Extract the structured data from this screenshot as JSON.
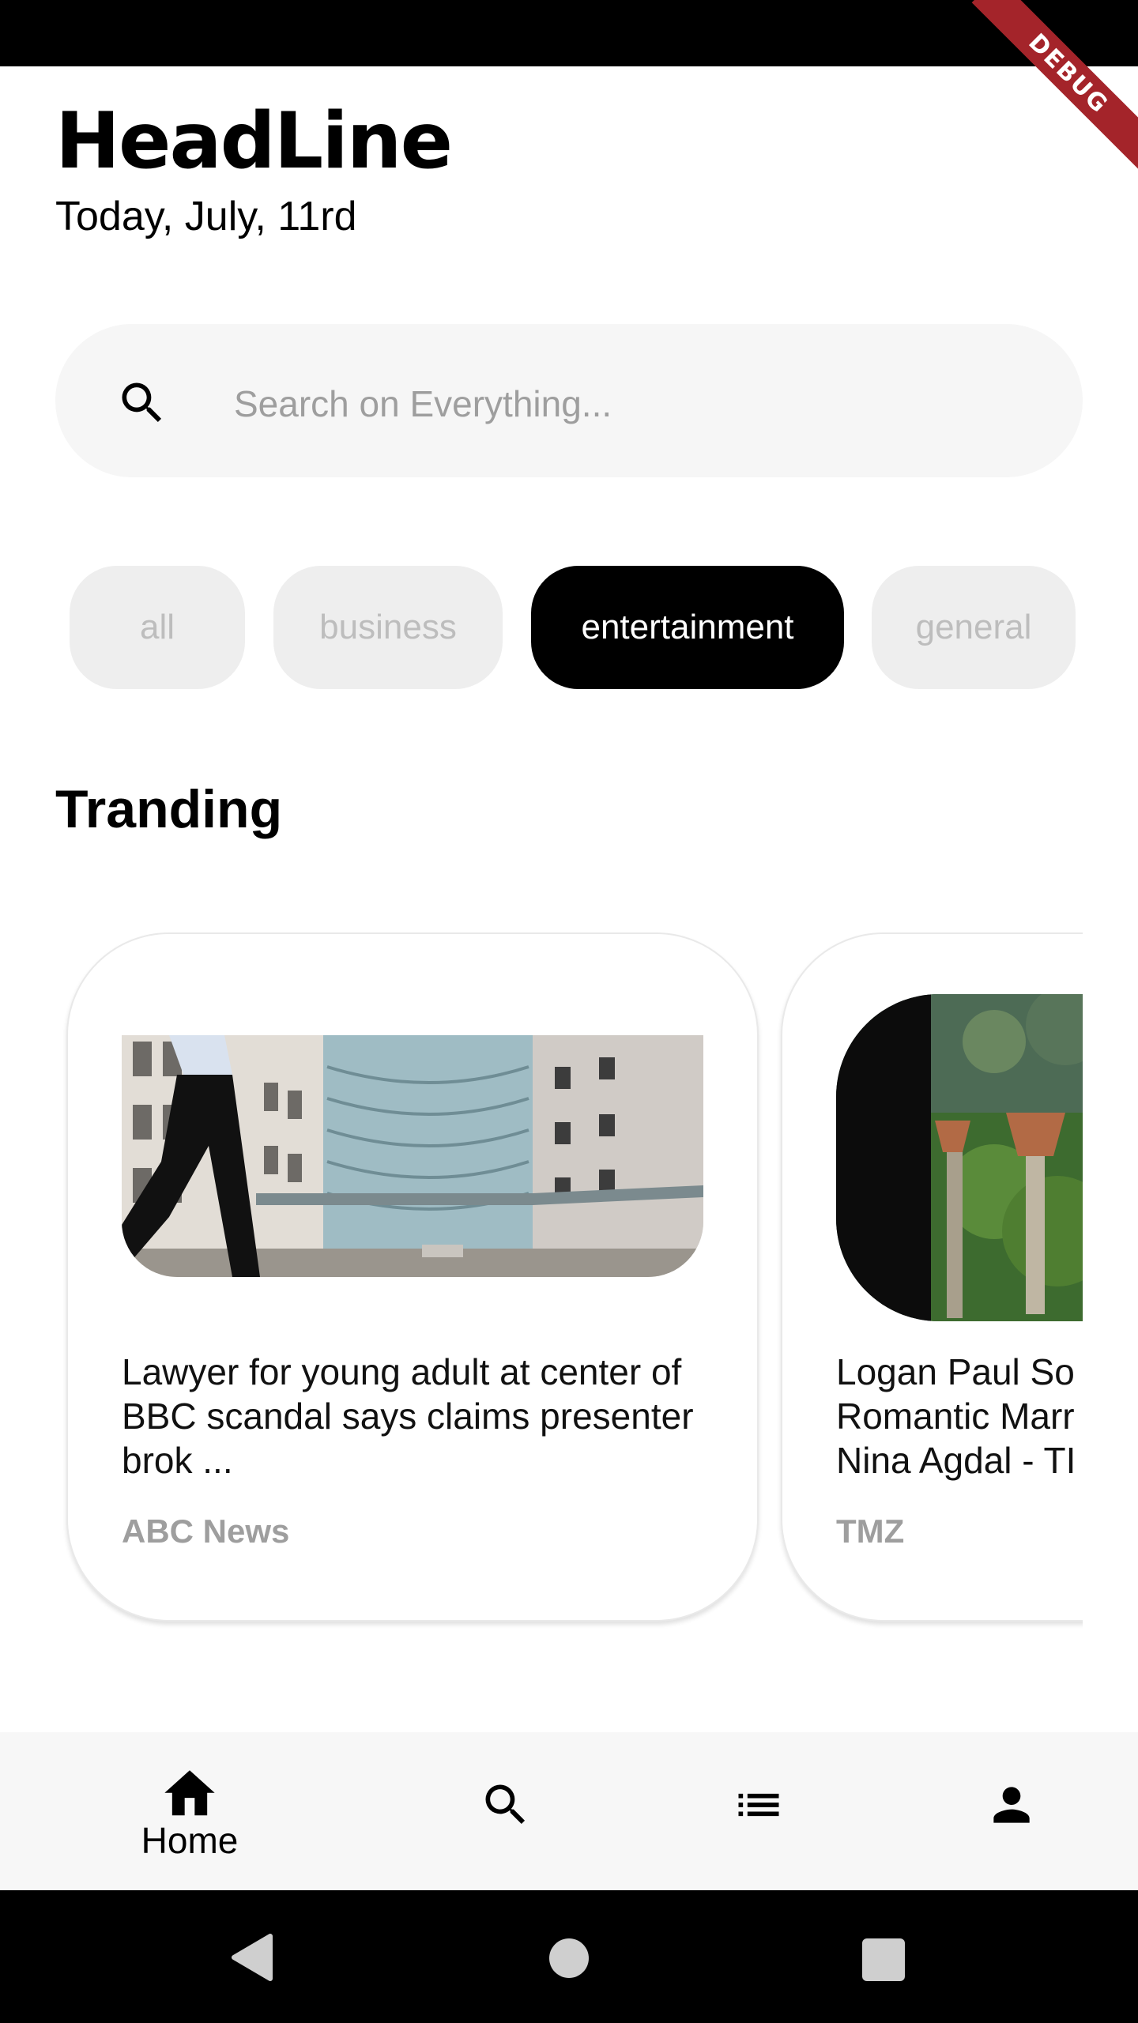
{
  "debug_banner": "DEBUG",
  "header": {
    "title": "HeadLine",
    "date": "Today, July, 11rd"
  },
  "search": {
    "placeholder": "Search on Everything...",
    "icon": "search-icon"
  },
  "categories": [
    {
      "label": "all",
      "active": false
    },
    {
      "label": "business",
      "active": false
    },
    {
      "label": "entertainment",
      "active": true
    },
    {
      "label": "general",
      "active": false
    }
  ],
  "trending": {
    "title": "Tranding",
    "cards": [
      {
        "title": "Lawyer for young adult at center of BBC scandal says claims presenter brok ...",
        "source": "ABC News"
      },
      {
        "title": "Logan Paul So Romantic Marr Nina Agdal - TI",
        "title_lines": [
          "Logan Paul So",
          "Romantic Marr",
          "Nina Agdal - TI"
        ],
        "source": "TMZ"
      }
    ]
  },
  "bottom_nav": {
    "items": [
      {
        "label": "Home",
        "icon": "home-icon",
        "active": true
      },
      {
        "label": "",
        "icon": "search-icon",
        "active": false
      },
      {
        "label": "",
        "icon": "list-icon",
        "active": false
      },
      {
        "label": "",
        "icon": "person-icon",
        "active": false
      }
    ]
  },
  "colors": {
    "accent": "#000000",
    "chip_inactive_bg": "#eeeeee",
    "chip_inactive_text": "#bdbdbd",
    "source_text": "#9e9e9e",
    "search_bg": "#f6f6f6"
  }
}
